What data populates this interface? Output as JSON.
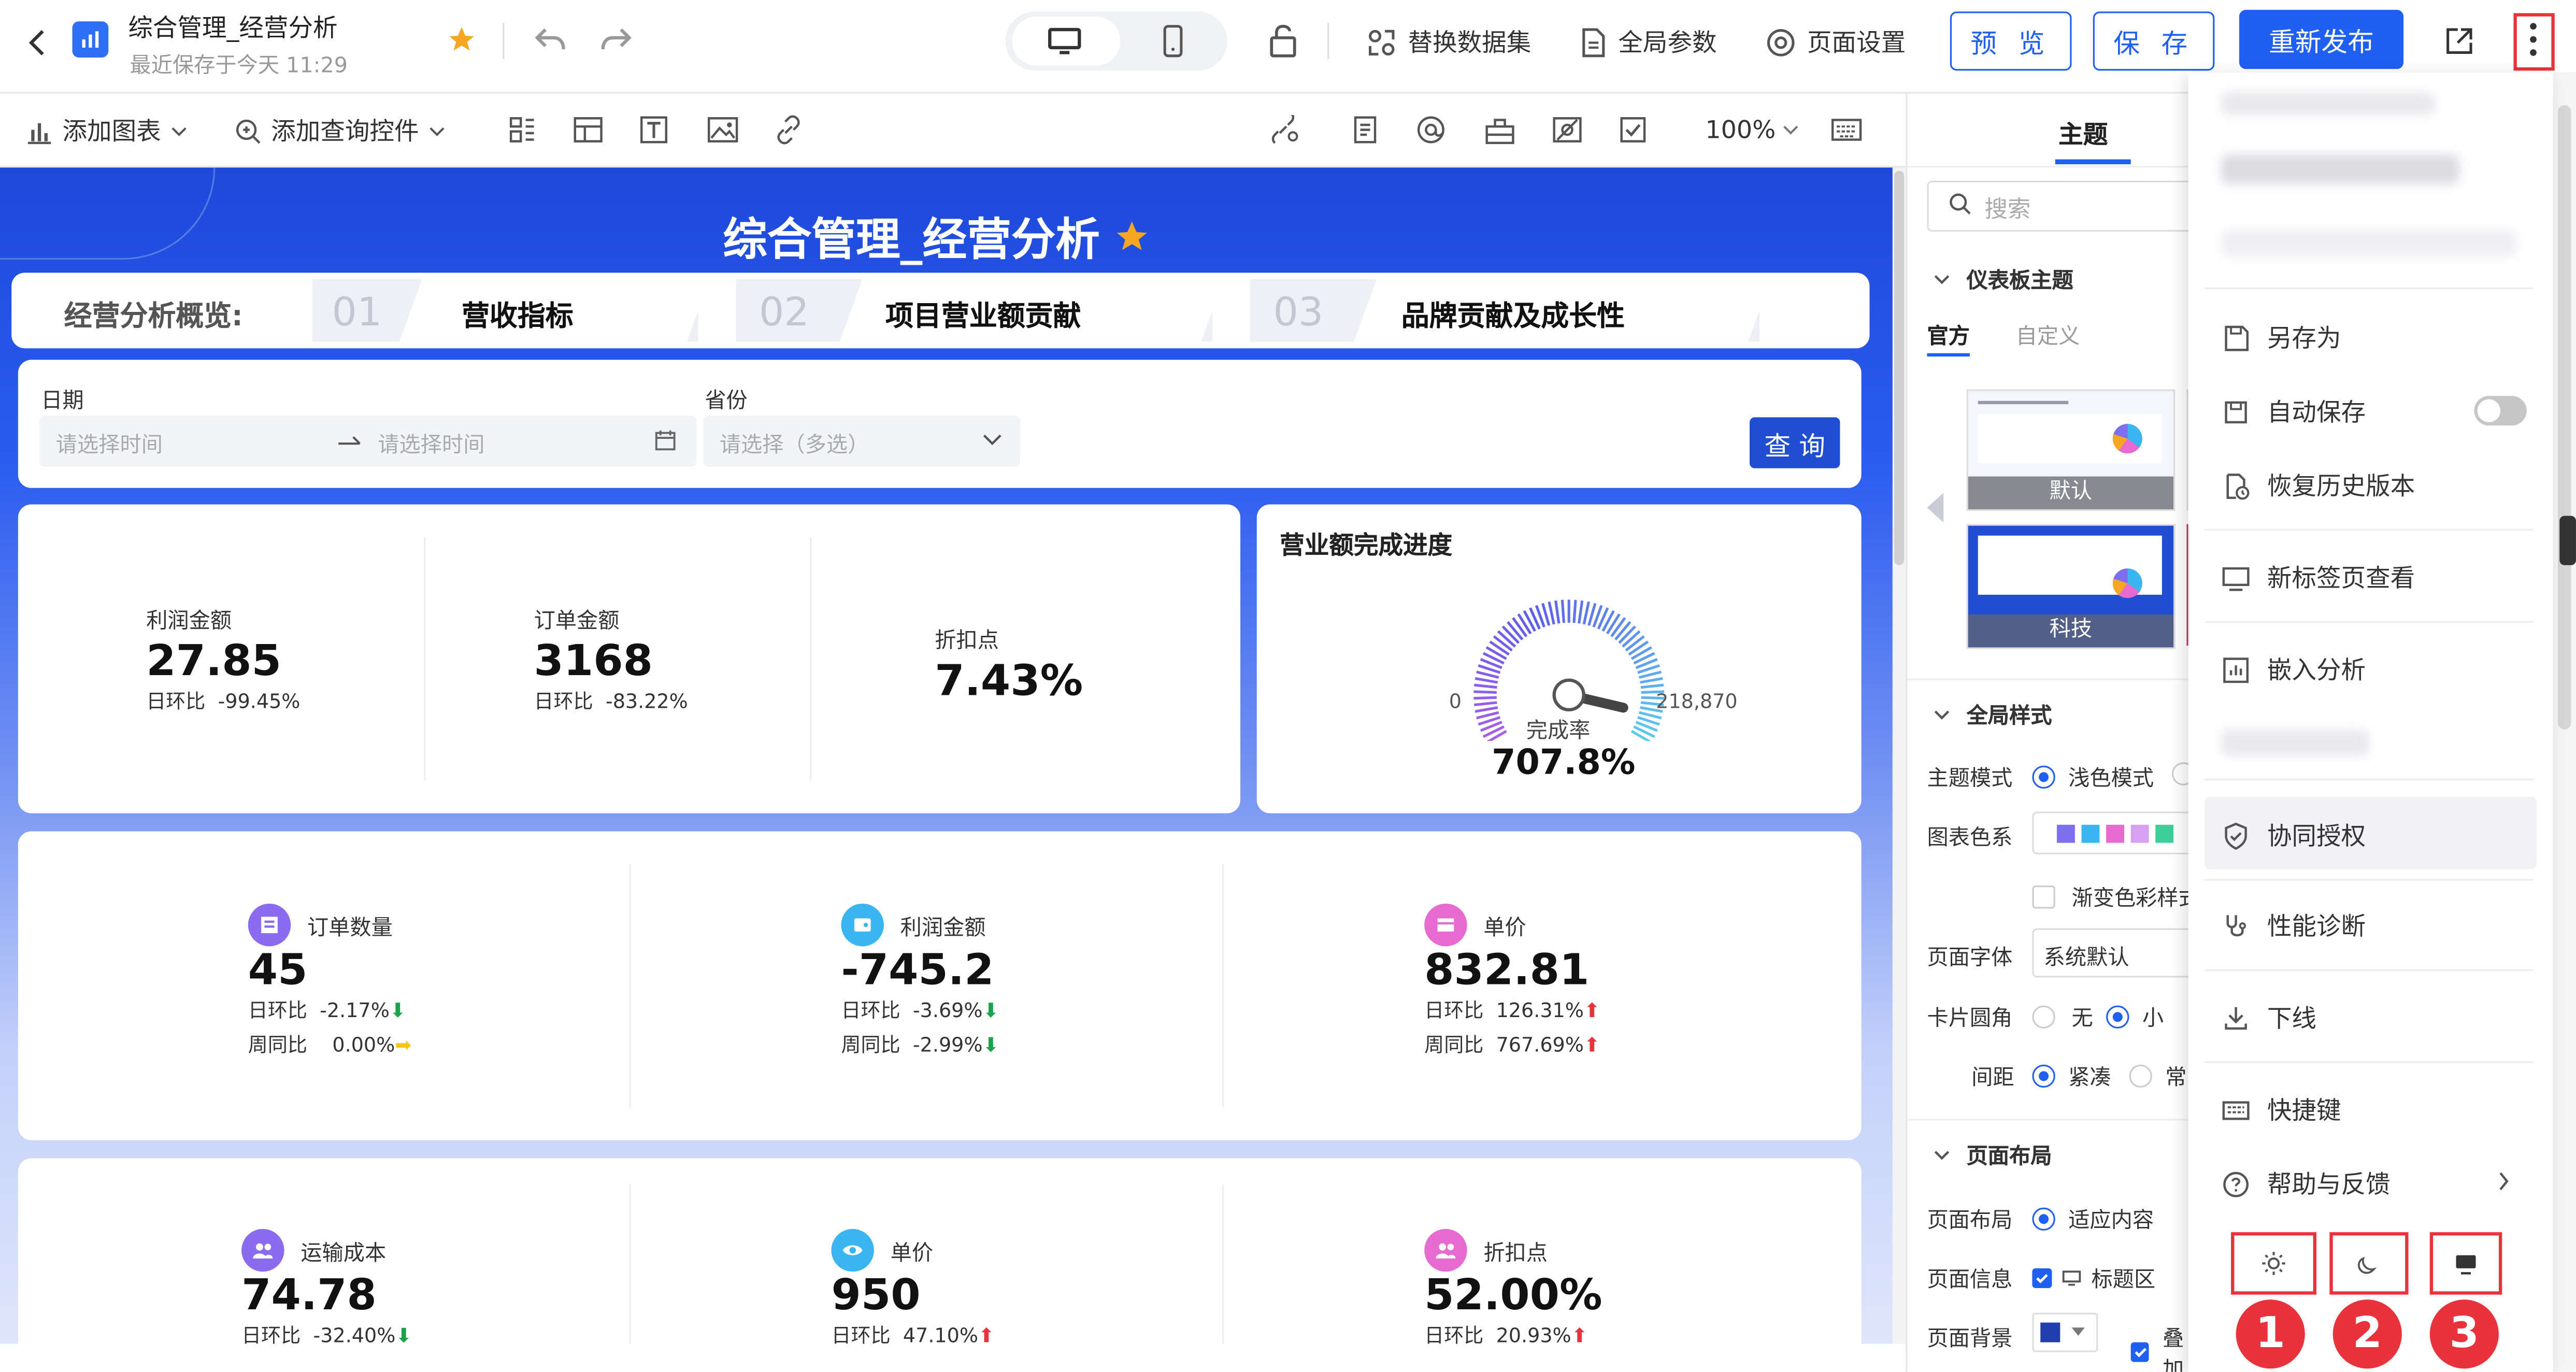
{
  "app": {
    "title": "综合管理_经营分析",
    "saved_time": "最近保存于今天 11:29"
  },
  "topbar": {
    "replace_dataset": "替换数据集",
    "global_params": "全局参数",
    "page_settings": "页面设置",
    "preview": "预 览",
    "save": "保 存",
    "republish": "重新发布"
  },
  "toolbar": {
    "add_chart": "添加图表",
    "add_query_control": "添加查询控件",
    "zoom": "100%"
  },
  "dashboard": {
    "title": "综合管理_经营分析",
    "nav_label": "经营分析概览:",
    "tabs": [
      {
        "num": "01",
        "label": "营收指标"
      },
      {
        "num": "02",
        "label": "项目营业额贡献"
      },
      {
        "num": "03",
        "label": "品牌贡献及成长性"
      }
    ],
    "filter": {
      "date_label": "日期",
      "date_start_placeholder": "请选择时间",
      "date_end_placeholder": "请选择时间",
      "province_label": "省份",
      "province_placeholder": "请选择（多选）",
      "query_button": "查 询"
    },
    "kpi_top": [
      {
        "label": "利润金额",
        "value": "27.85",
        "sub_label": "日环比",
        "sub_value": "-99.45%"
      },
      {
        "label": "订单金额",
        "value": "3168",
        "sub_label": "日环比",
        "sub_value": "-83.22%"
      },
      {
        "label": "折扣点",
        "value": "7.43%"
      }
    ],
    "gauge": {
      "title": "营业额完成进度",
      "min": "0",
      "max": "218,870",
      "label": "完成率",
      "value": "707.8%",
      "progress": 7.078
    },
    "kpi_mid": [
      {
        "label": "订单数量",
        "value": "45",
        "d_label": "日环比",
        "d_value": "-2.17%",
        "w_label": "周同比",
        "w_value": "0.00%",
        "icon_color": "#8b6cf0"
      },
      {
        "label": "利润金额",
        "value": "-745.2",
        "d_label": "日环比",
        "d_value": "-3.69%",
        "w_label": "周同比",
        "w_value": "-2.99%",
        "icon_color": "#3ab5f0"
      },
      {
        "label": "单价",
        "value": "832.81",
        "d_label": "日环比",
        "d_value": "126.31%",
        "w_label": "周同比",
        "w_value": "767.69%",
        "icon_color": "#e86ad0"
      }
    ],
    "kpi_bottom": [
      {
        "label": "运输成本",
        "value": "74.78",
        "d_label": "日环比",
        "d_value": "-32.40%",
        "icon_color": "#8b6cf0"
      },
      {
        "label": "单价",
        "value": "950",
        "d_label": "日环比",
        "d_value": "47.10%",
        "icon_color": "#3ab5f0"
      },
      {
        "label": "折扣点",
        "value": "52.00%",
        "d_label": "日环比",
        "d_value": "20.93%",
        "icon_color": "#e86ad0"
      }
    ]
  },
  "right_panel": {
    "tab": "主题",
    "search_placeholder": "搜索",
    "dashboard_theme": "仪表板主题",
    "official": "官方",
    "custom": "自定义",
    "theme_default": "默认",
    "theme_tech": "科技",
    "global_style": "全局样式",
    "theme_mode_label": "主题模式",
    "theme_mode_value": "浅色模式",
    "chart_color_label": "图表色系",
    "chart_colors": [
      "#7b6ff0",
      "#3ab5f0",
      "#e86ad0",
      "#d8a0f0",
      "#3ccf9c"
    ],
    "gradient_label": "渐变色彩样式",
    "page_font_label": "页面字体",
    "page_font_value": "系统默认",
    "card_radius_label": "卡片圆角",
    "radius_none": "无",
    "radius_small": "小",
    "spacing_label": "间距",
    "spacing_compact": "紧凑",
    "spacing_normal": "常",
    "page_layout": "页面布局",
    "layout_label": "页面布局",
    "layout_value": "适应内容",
    "page_info_label": "页面信息",
    "page_info_value": "标题区",
    "page_bg_label": "页面背景",
    "page_bg_value": "叠加"
  },
  "menu": {
    "items": [
      {
        "label": "另存为"
      },
      {
        "label": "自动保存"
      },
      {
        "label": "恢复历史版本"
      },
      {
        "label": "新标签页查看"
      },
      {
        "label": "嵌入分析"
      },
      {
        "label": "协同授权"
      },
      {
        "label": "性能诊断"
      },
      {
        "label": "下线"
      },
      {
        "label": "快捷键"
      },
      {
        "label": "帮助与反馈"
      }
    ],
    "badges": [
      "1",
      "2",
      "3"
    ]
  }
}
